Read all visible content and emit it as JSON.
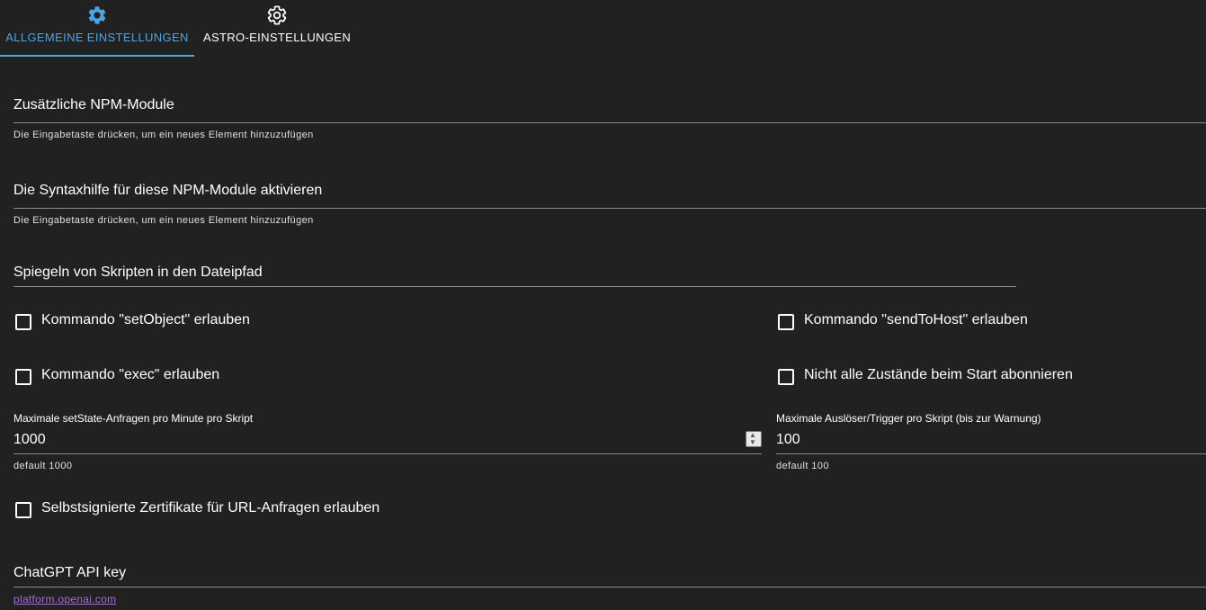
{
  "tabs": [
    {
      "label": "ALLGEMEINE EINSTELLUNGEN",
      "icon": "gear-icon",
      "active": true
    },
    {
      "label": "ASTRO-EINSTELLUNGEN",
      "icon": "gear-outline-icon",
      "active": false
    }
  ],
  "npm_modules": {
    "label": "Zusätzliche NPM-Module",
    "helper": "Die Eingabetaste drücken, um ein neues Element hinzuzufügen"
  },
  "syntax_help": {
    "label": "Die Syntaxhilfe für diese NPM-Module aktivieren",
    "helper": "Die Eingabetaste drücken, um ein neues Element hinzuzufügen"
  },
  "mirror_path": {
    "label": "Spiegeln von Skripten in den Dateipfad"
  },
  "checkboxes": {
    "set_object": {
      "label": "Kommando \"setObject\" erlauben",
      "checked": false
    },
    "send_to_host": {
      "label": "Kommando \"sendToHost\" erlauben",
      "checked": false
    },
    "exec": {
      "label": "Kommando \"exec\" erlauben",
      "checked": false
    },
    "no_subscribe": {
      "label": "Nicht alle Zustände beim Start abonnieren",
      "checked": false
    },
    "self_signed": {
      "label": "Selbstsignierte Zertifikate für URL-Anfragen erlauben",
      "checked": false
    }
  },
  "max_setstate": {
    "label": "Maximale setState-Anfragen pro Minute pro Skript",
    "value": "1000",
    "helper": "default 1000"
  },
  "max_triggers": {
    "label": "Maximale Auslöser/Trigger pro Skript (bis zur Warnung)",
    "value": "100",
    "helper": "default 100"
  },
  "chatgpt": {
    "label": "ChatGPT API key",
    "link": "platform.openai.com"
  },
  "colors": {
    "background": "#212121",
    "accent": "#4fa3e0",
    "link": "#a66bd6"
  }
}
